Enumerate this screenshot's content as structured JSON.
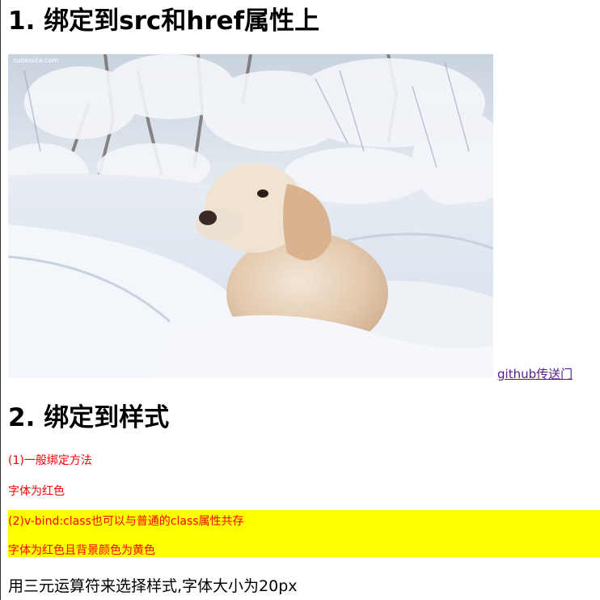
{
  "sections": {
    "heading1": "1. 绑定到src和href属性上",
    "heading2": "2. 绑定到样式"
  },
  "photo": {
    "watermark": "sudasuta.com"
  },
  "link": {
    "text": "github传送门"
  },
  "styles": {
    "line1": "(1)一般绑定方法",
    "line2": "字体为红色",
    "line3": "(2)v-bind:class也可以与普通的class属性共存",
    "line4": "字体为红色且背景颜色为黄色",
    "line5": "用三元运算符来选择样式,字体大小为20px"
  },
  "colors": {
    "red_text": "#ff0000",
    "yellow_bg": "#ffff00",
    "link": "#551a8b"
  }
}
